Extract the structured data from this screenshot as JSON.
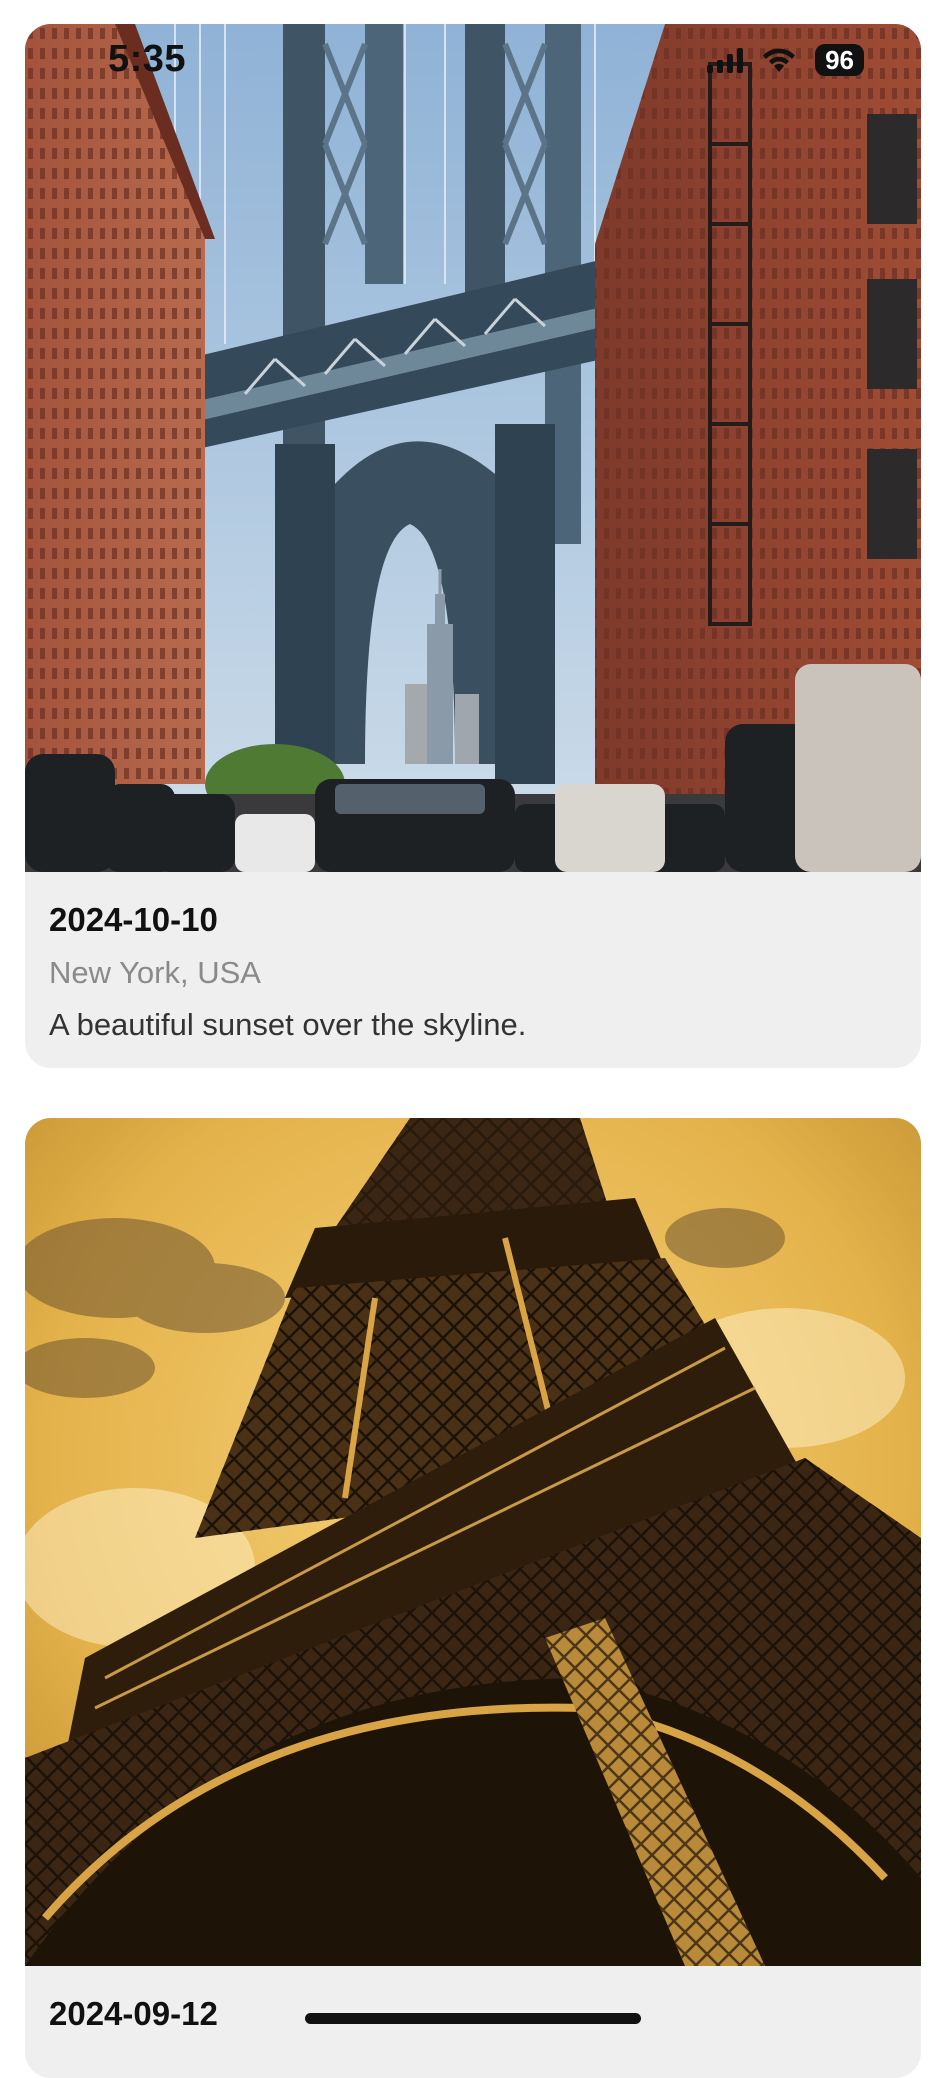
{
  "status_bar": {
    "time": "5:35",
    "battery": "96",
    "icons": [
      "signal-icon",
      "wifi-icon",
      "battery-icon"
    ]
  },
  "feed": {
    "items": [
      {
        "date": "2024-10-10",
        "location": "New York, USA",
        "caption": "A beautiful sunset over the skyline.",
        "photo": "manhattan-bridge-photo"
      },
      {
        "date": "2024-09-12",
        "photo": "eiffel-tower-photo"
      }
    ]
  },
  "colors": {
    "card_background": "#efefef",
    "secondary_text": "#8a8a8a",
    "brick": "#9b4a36",
    "bridge_steel": "#3f5566",
    "sky_blue": "#b9cfe2",
    "golden_sky": "#e4b24a",
    "tower_dark": "#3a2612"
  }
}
